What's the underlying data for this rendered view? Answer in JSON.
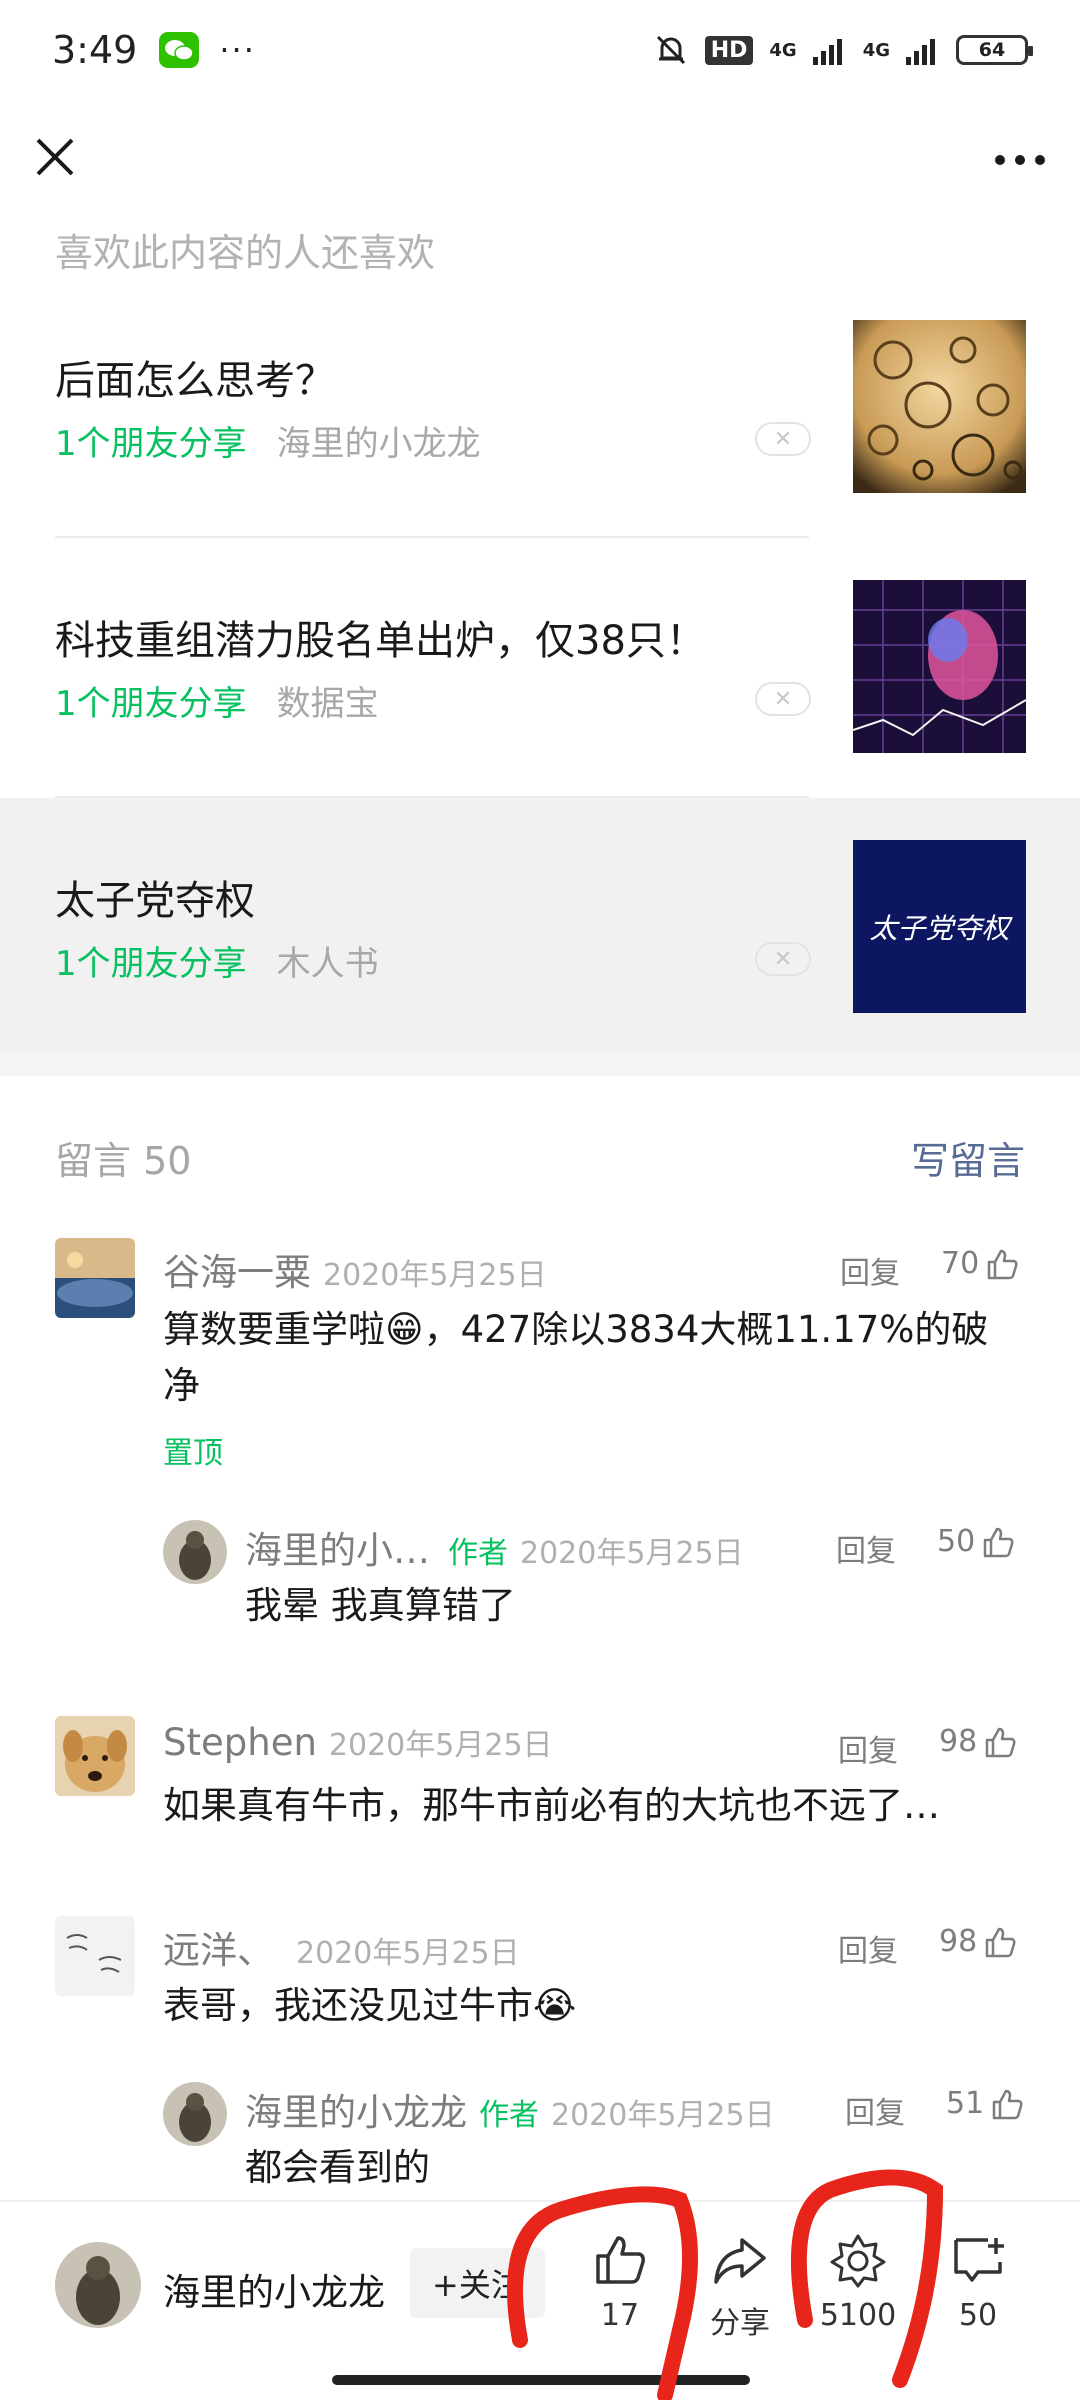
{
  "status_bar": {
    "time": "3:49",
    "more": "···",
    "hd": "HD",
    "signal1": "4G",
    "signal2": "4G",
    "battery": "64"
  },
  "recommend": {
    "heading": "喜欢此内容的人还喜欢",
    "items": [
      {
        "title": "后面怎么思考？",
        "friend": "1个朋友分享",
        "source": "海里的小龙龙"
      },
      {
        "title": "科技重组潜力股名单出炉，仅38只！",
        "friend": "1个朋友分享",
        "source": "数据宝"
      },
      {
        "title": "太子党夺权",
        "friend": "1个朋友分享",
        "source": "木人书",
        "thumb_text": "太子党夺权"
      }
    ]
  },
  "comments": {
    "heading": "留言 50",
    "write": "写留言",
    "reply_label": "回复",
    "items": [
      {
        "name": "谷海一粟",
        "date": "2020年5月25日",
        "likes": "70",
        "text_line1": "算数要重学啦😁，427除以3834大概11.17%的破",
        "text_line2": "净",
        "pin": "置顶"
      },
      {
        "name": "海里的小…",
        "author": "作者",
        "date": "2020年5月25日",
        "likes": "50",
        "text": "我晕 我真算错了"
      },
      {
        "name": "Stephen",
        "date": "2020年5月25日",
        "likes": "98",
        "text": "如果真有牛市，那牛市前必有的大坑也不远了…"
      },
      {
        "name": "远洋、",
        "date": "2020年5月25日",
        "likes": "98",
        "text": "表哥，我还没见过牛市😭"
      },
      {
        "name": "海里的小龙龙",
        "author": "作者",
        "date": "2020年5月25日",
        "likes": "51",
        "text": "都会看到的"
      }
    ]
  },
  "bottom_bar": {
    "name": "海里的小龙龙",
    "follow": "+关注",
    "like_count": "17",
    "share_label": "分享",
    "wow_count": "5100",
    "comment_count": "50"
  },
  "colors": {
    "accent_green": "#07c160",
    "link_blue": "#576b95",
    "annotation_red": "#e8251a"
  }
}
